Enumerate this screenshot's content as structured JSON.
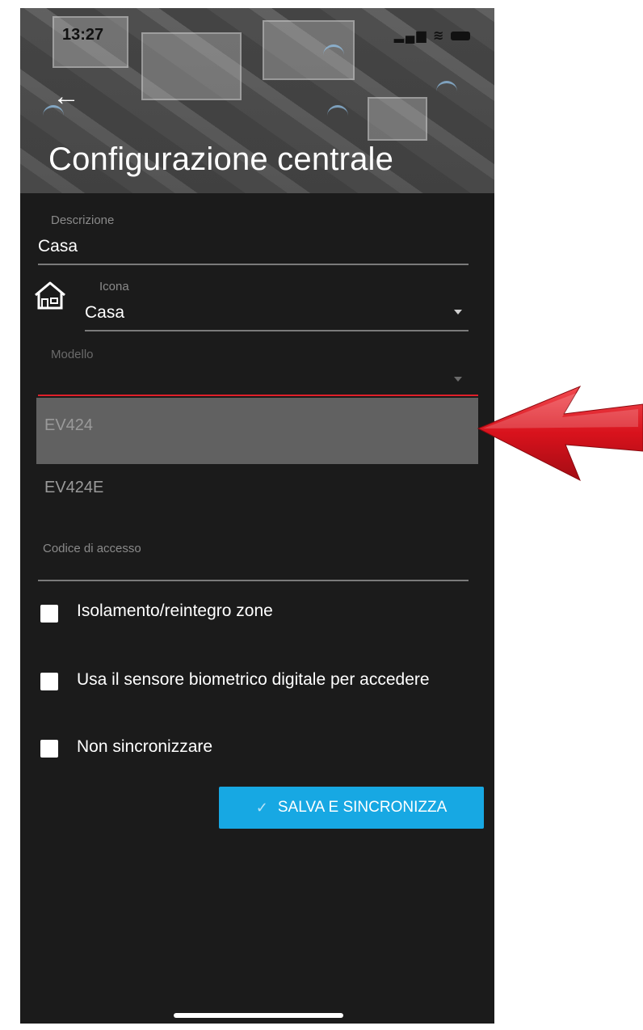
{
  "status": {
    "time": "13:27"
  },
  "header": {
    "title": "Configurazione centrale"
  },
  "form": {
    "description": {
      "label": "Descrizione",
      "value": "Casa"
    },
    "icon": {
      "label": "Icona",
      "value": "Casa",
      "icon_name": "house-icon"
    },
    "model": {
      "label": "Modello",
      "value": "",
      "options": [
        "EV424",
        "EV424E"
      ],
      "highlighted_option": "EV424"
    },
    "access_code": {
      "label": "Codice di accesso",
      "value": ""
    },
    "checkboxes": [
      {
        "label": "Isolamento/reintegro zone",
        "checked": false
      },
      {
        "label": "Usa il sensore biometrico digitale per accedere",
        "checked": false
      },
      {
        "label": "Non sincronizzare",
        "checked": false
      }
    ],
    "save_button": {
      "label": "SALVA E SINCRONIZZA",
      "icon": "check-icon"
    }
  },
  "colors": {
    "accent": "#17a8e3",
    "focus_line": "#e0202a",
    "annotation_arrow": "#d8121c",
    "background": "#1b1b1b"
  }
}
